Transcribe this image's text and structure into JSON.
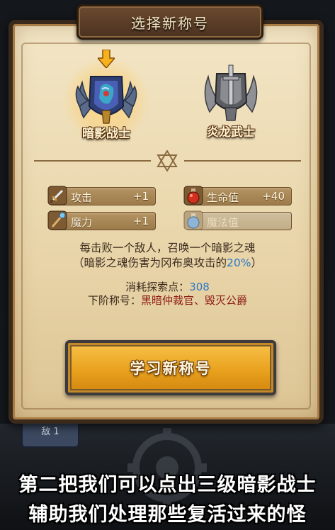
{
  "dialog": {
    "title": "选择新称号"
  },
  "titles": [
    {
      "name": "暗影战士",
      "selected": true,
      "emblem": "shadow-warrior-emblem"
    },
    {
      "name": "炎龙武士",
      "selected": false,
      "emblem": "flame-dragon-emblem"
    }
  ],
  "stats": [
    {
      "icon": "sword-icon",
      "label": "攻击",
      "value": "+1",
      "enabled": true
    },
    {
      "icon": "potion-red-icon",
      "label": "生命值",
      "value": "+40",
      "enabled": true
    },
    {
      "icon": "staff-icon",
      "label": "魔力",
      "value": "+1",
      "enabled": true
    },
    {
      "icon": "potion-blue-icon",
      "label": "魔法值",
      "value": "",
      "enabled": false
    }
  ],
  "description": {
    "line1": "每击败一个敌人，召唤一个暗影之魂",
    "line2_prefix": "（暗影之魂伤害为冈布奥攻击的",
    "line2_value": "20%",
    "line2_suffix": "）"
  },
  "cost": {
    "label": "消耗探索点：",
    "value": "308"
  },
  "next_titles": {
    "label": "下阶称号：",
    "value": "黑暗仲裁官、毁灭公爵"
  },
  "learn_button": {
    "label": "学习新称号"
  },
  "background": {
    "side_tab_label": "敌 1"
  },
  "subtitles": {
    "line1": "第二把我们可以点出三级暗影战士",
    "line2": "辅助我们处理那些复活过来的怪"
  },
  "colors": {
    "highlight_blue": "#2a78c8",
    "next_title_red": "#8b1a12",
    "button_gold": "#e9a21e",
    "panel_parchment": "#ead7ab"
  }
}
